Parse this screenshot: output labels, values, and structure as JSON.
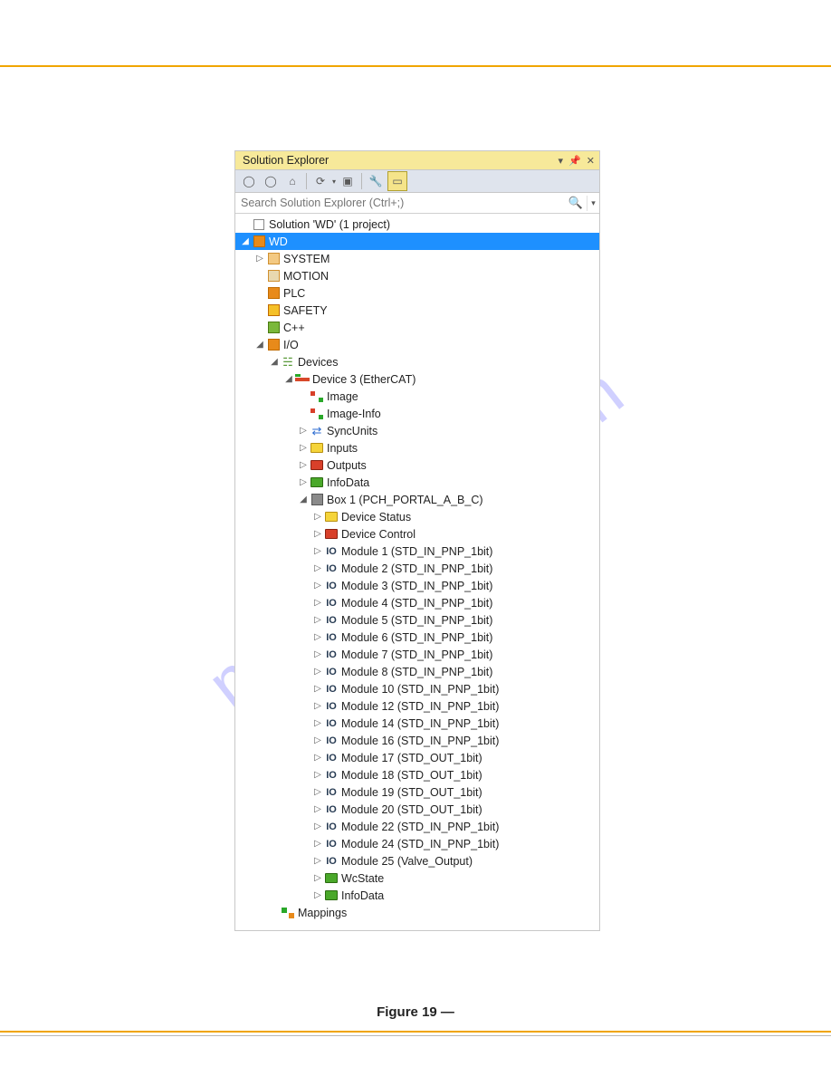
{
  "watermark": "manualslib.com",
  "caption": "Figure 19 —",
  "panel": {
    "title": "Solution Explorer",
    "search_placeholder": "Search Solution Explorer (Ctrl+;)",
    "root": "Solution 'WD' (1 project)",
    "project": "WD",
    "nodes": {
      "system": "SYSTEM",
      "motion": "MOTION",
      "plc": "PLC",
      "safety": "SAFETY",
      "cpp": "C++",
      "io": "I/O",
      "devices": "Devices",
      "device3": "Device 3 (EtherCAT)",
      "image": "Image",
      "imageinfo": "Image-Info",
      "syncunits": "SyncUnits",
      "inputs": "Inputs",
      "outputs": "Outputs",
      "infodata": "InfoData",
      "box1": "Box 1 (PCH_PORTAL_A_B_C)",
      "devstatus": "Device Status",
      "devcontrol": "Device Control",
      "wcstate": "WcState",
      "infodata2": "InfoData",
      "mappings": "Mappings"
    },
    "modules": [
      "Module 1 (STD_IN_PNP_1bit)",
      "Module 2 (STD_IN_PNP_1bit)",
      "Module 3 (STD_IN_PNP_1bit)",
      "Module 4 (STD_IN_PNP_1bit)",
      "Module 5 (STD_IN_PNP_1bit)",
      "Module 6 (STD_IN_PNP_1bit)",
      "Module 7 (STD_IN_PNP_1bit)",
      "Module 8 (STD_IN_PNP_1bit)",
      "Module 10 (STD_IN_PNP_1bit)",
      "Module 12 (STD_IN_PNP_1bit)",
      "Module 14 (STD_IN_PNP_1bit)",
      "Module 16 (STD_IN_PNP_1bit)",
      "Module 17 (STD_OUT_1bit)",
      "Module 18 (STD_OUT_1bit)",
      "Module 19 (STD_OUT_1bit)",
      "Module 20 (STD_OUT_1bit)",
      "Module 22 (STD_IN_PNP_1bit)",
      "Module 24 (STD_IN_PNP_1bit)",
      "Module 25 (Valve_Output)"
    ]
  }
}
